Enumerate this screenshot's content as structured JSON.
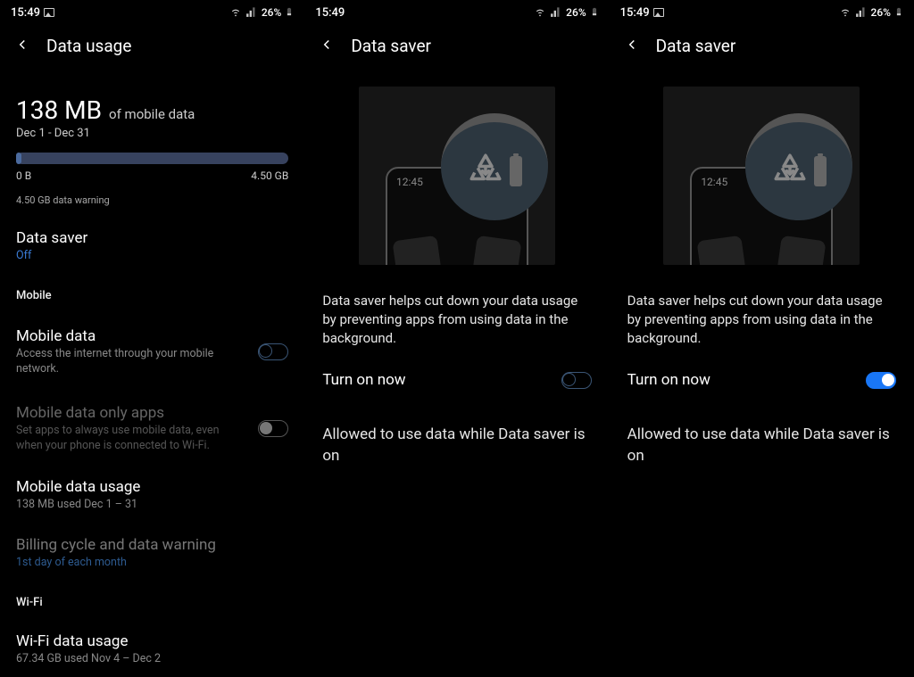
{
  "status": {
    "time": "15:49",
    "battery": "26%"
  },
  "screen1": {
    "title": "Data usage",
    "usage_amount": "138 MB",
    "usage_of": "of mobile data",
    "period": "Dec 1 - Dec 31",
    "bar_min": "0 B",
    "bar_max": "4.50 GB",
    "warning": "4.50 GB data warning",
    "saver_title": "Data saver",
    "saver_status": "Off",
    "cat_mobile": "Mobile",
    "mobile_data_title": "Mobile data",
    "mobile_data_sub": "Access the internet through your mobile network.",
    "only_apps_title": "Mobile data only apps",
    "only_apps_sub": "Set apps to always use mobile data, even when your phone is connected to Wi-Fi.",
    "mobile_usage_title": "Mobile data usage",
    "mobile_usage_sub": "138 MB used Dec 1 – 31",
    "billing_title": "Billing cycle and data warning",
    "billing_sub": "1st day of each month",
    "cat_wifi": "Wi-Fi",
    "wifi_usage_title": "Wi-Fi data usage",
    "wifi_usage_sub": "67.34 GB used Nov 4 – Dec 2"
  },
  "screen2": {
    "title": "Data saver",
    "illus_time": "12:45",
    "desc": "Data saver helps cut down your data usage by preventing apps from using data in the background.",
    "turn_label": "Turn on now",
    "allowed": "Allowed to use data while Data saver is on"
  },
  "screen3": {
    "title": "Data saver",
    "illus_time": "12:45",
    "desc": "Data saver helps cut down your data usage by preventing apps from using data in the background.",
    "turn_label": "Turn on now",
    "allowed": "Allowed to use data while Data saver is on"
  }
}
